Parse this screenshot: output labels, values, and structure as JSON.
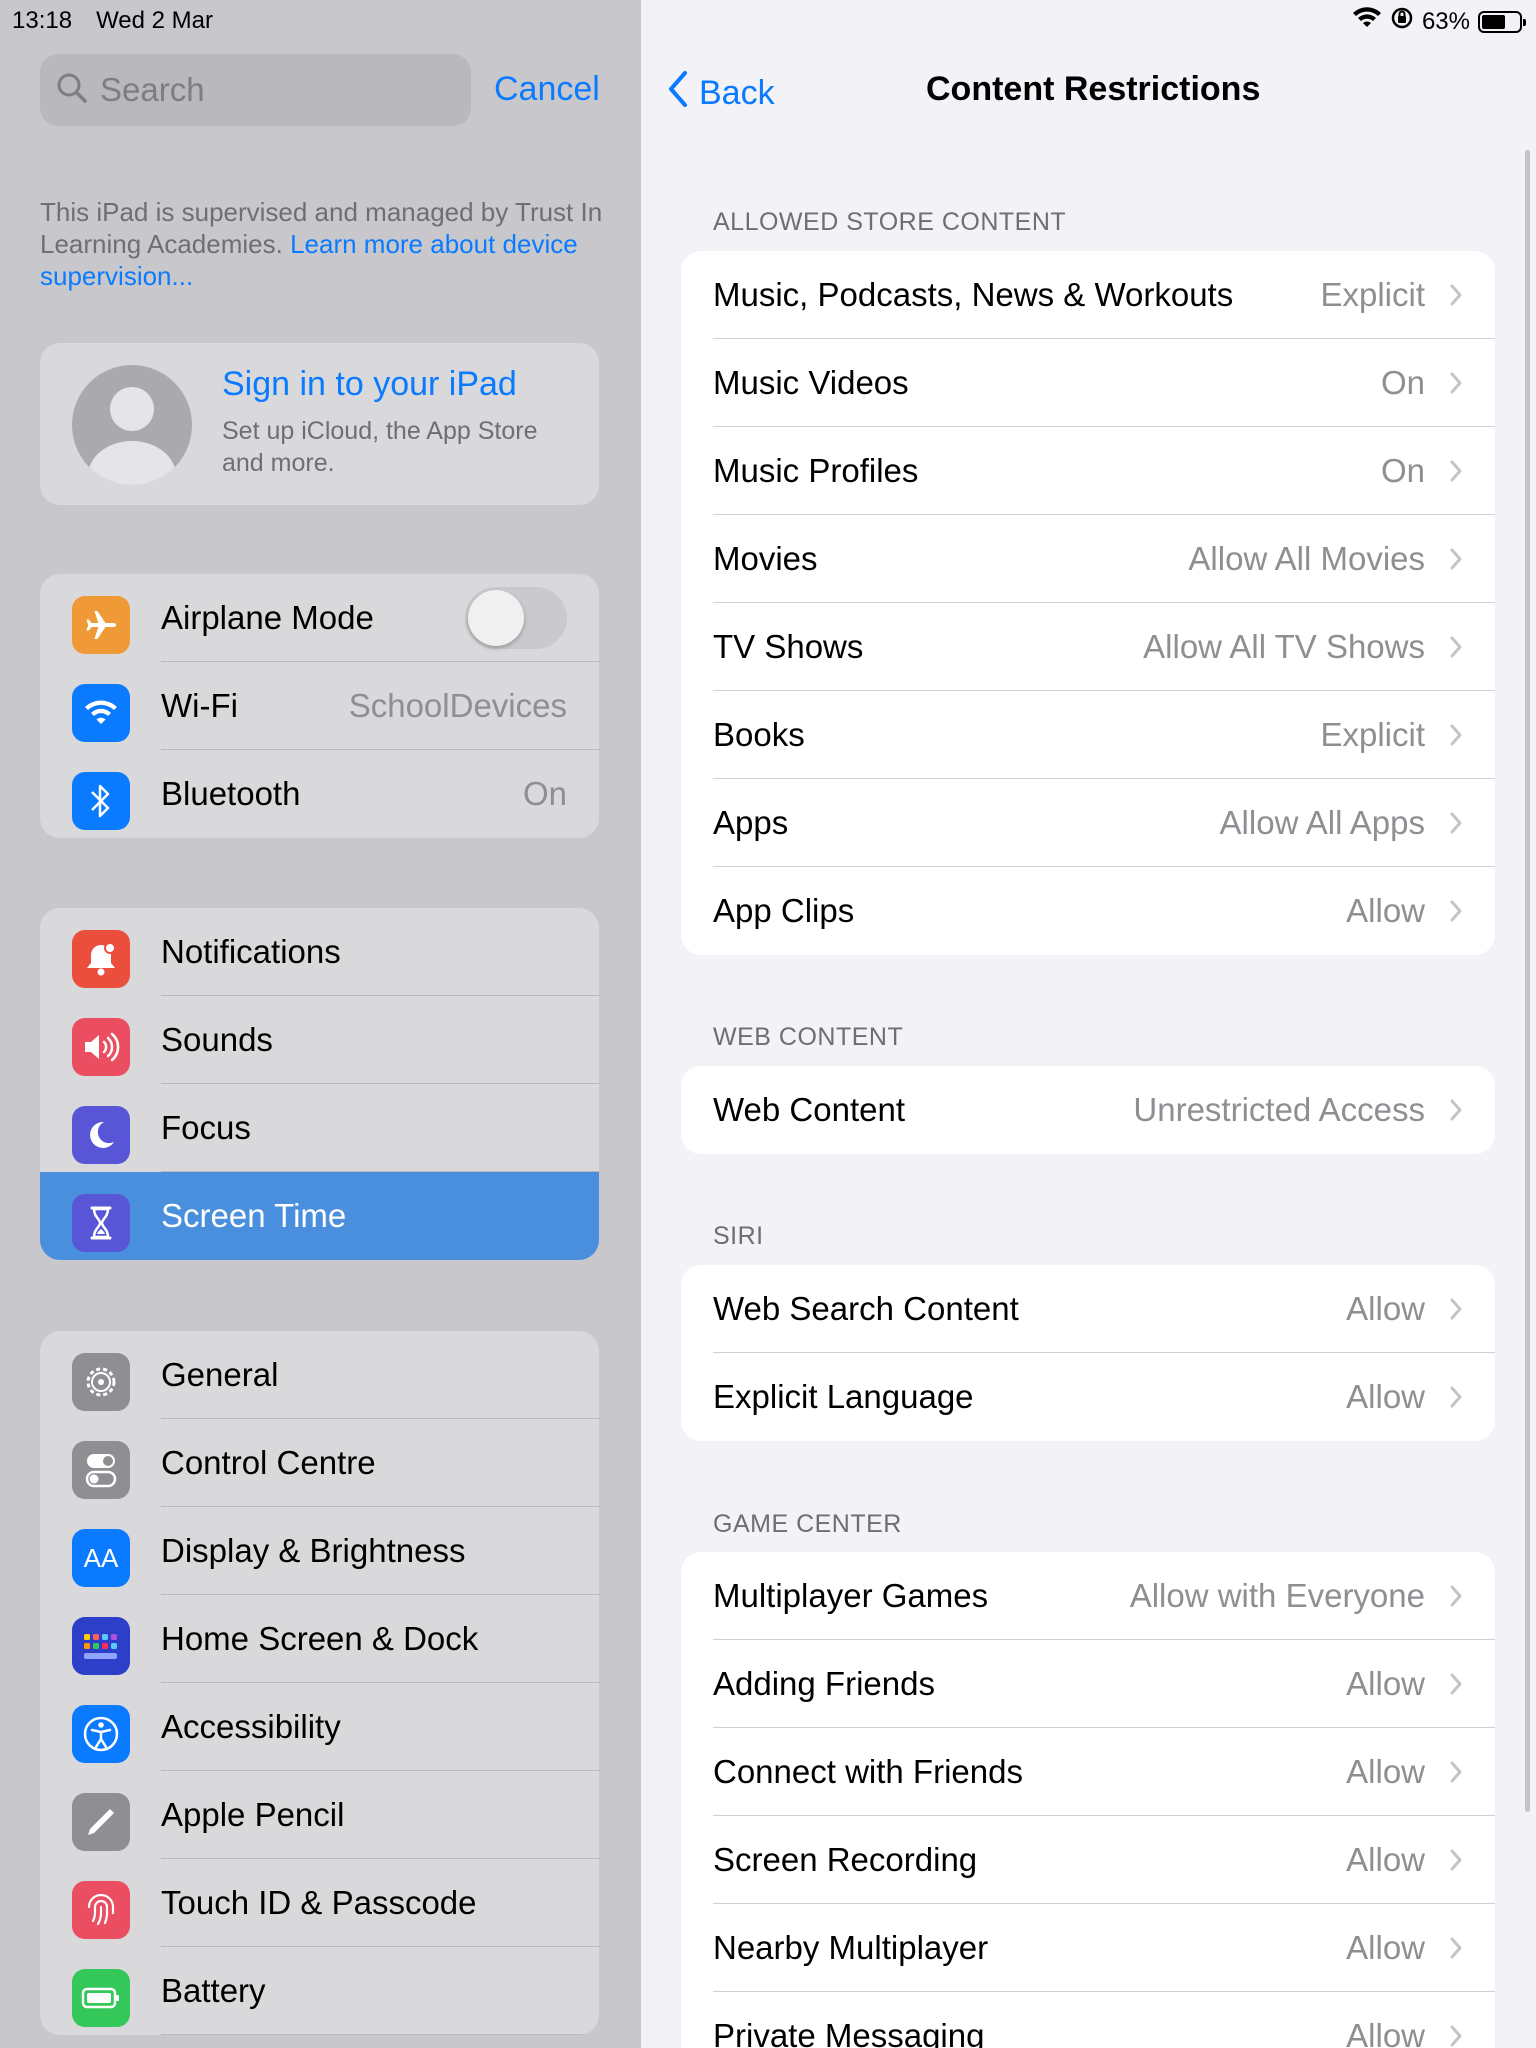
{
  "status_bar": {
    "time": "13:18",
    "date": "Wed 2 Mar",
    "battery": "63%",
    "battery_level": 0.63
  },
  "sidebar": {
    "search": {
      "placeholder": "Search"
    },
    "cancel_label": "Cancel",
    "supervision": {
      "text": "This iPad is supervised and managed by Trust In Learning Academies.",
      "link": "Learn more about device supervision..."
    },
    "profile": {
      "title": "Sign in to your iPad",
      "subtitle": "Set up iCloud, the App Store and more."
    },
    "connectivity": [
      {
        "label": "Airplane Mode",
        "icon": "airplane-icon",
        "color": "#f09a37",
        "toggle": false
      },
      {
        "label": "Wi-Fi",
        "value": "SchoolDevices",
        "icon": "wifi-icon",
        "color": "#0a7aff"
      },
      {
        "label": "Bluetooth",
        "value": "On",
        "icon": "bluetooth-icon",
        "color": "#0a7aff"
      }
    ],
    "notifications_group": [
      {
        "label": "Notifications",
        "icon": "bell-icon",
        "color": "#eb4e3d"
      },
      {
        "label": "Sounds",
        "icon": "speaker-icon",
        "color": "#eb4d61"
      },
      {
        "label": "Focus",
        "icon": "moon-icon",
        "color": "#5856d6"
      },
      {
        "label": "Screen Time",
        "icon": "hourglass-icon",
        "color": "#5856d6",
        "selected": true
      }
    ],
    "general_group": [
      {
        "label": "General",
        "icon": "gear-icon",
        "color": "#8e8e93"
      },
      {
        "label": "Control Centre",
        "icon": "switches-icon",
        "color": "#8e8e93"
      },
      {
        "label": "Display & Brightness",
        "icon": "text-size-icon",
        "color": "#0a7aff"
      },
      {
        "label": "Home Screen & Dock",
        "icon": "app-grid-icon",
        "color": "#2d3ec9"
      },
      {
        "label": "Accessibility",
        "icon": "accessibility-icon",
        "color": "#0a7aff"
      },
      {
        "label": "Apple Pencil",
        "icon": "pencil-icon",
        "color": "#8e8e93"
      },
      {
        "label": "Touch ID & Passcode",
        "icon": "fingerprint-icon",
        "color": "#eb4d61"
      },
      {
        "label": "Battery",
        "icon": "battery-icon",
        "color": "#34c759"
      }
    ]
  },
  "detail": {
    "back_label": "Back",
    "title": "Content Restrictions",
    "sections": [
      {
        "header": "ALLOWED STORE CONTENT",
        "rows": [
          {
            "label": "Music, Podcasts, News & Workouts",
            "value": "Explicit"
          },
          {
            "label": "Music Videos",
            "value": "On"
          },
          {
            "label": "Music Profiles",
            "value": "On"
          },
          {
            "label": "Movies",
            "value": "Allow All Movies"
          },
          {
            "label": "TV Shows",
            "value": "Allow All TV Shows"
          },
          {
            "label": "Books",
            "value": "Explicit"
          },
          {
            "label": "Apps",
            "value": "Allow All Apps"
          },
          {
            "label": "App Clips",
            "value": "Allow"
          }
        ]
      },
      {
        "header": "WEB CONTENT",
        "rows": [
          {
            "label": "Web Content",
            "value": "Unrestricted Access"
          }
        ]
      },
      {
        "header": "SIRI",
        "rows": [
          {
            "label": "Web Search Content",
            "value": "Allow"
          },
          {
            "label": "Explicit Language",
            "value": "Allow"
          }
        ]
      },
      {
        "header": "GAME CENTER",
        "rows": [
          {
            "label": "Multiplayer Games",
            "value": "Allow with Everyone"
          },
          {
            "label": "Adding Friends",
            "value": "Allow"
          },
          {
            "label": "Connect with Friends",
            "value": "Allow"
          },
          {
            "label": "Screen Recording",
            "value": "Allow"
          },
          {
            "label": "Nearby Multiplayer",
            "value": "Allow"
          },
          {
            "label": "Private Messaging",
            "value": "Allow"
          }
        ]
      }
    ]
  }
}
